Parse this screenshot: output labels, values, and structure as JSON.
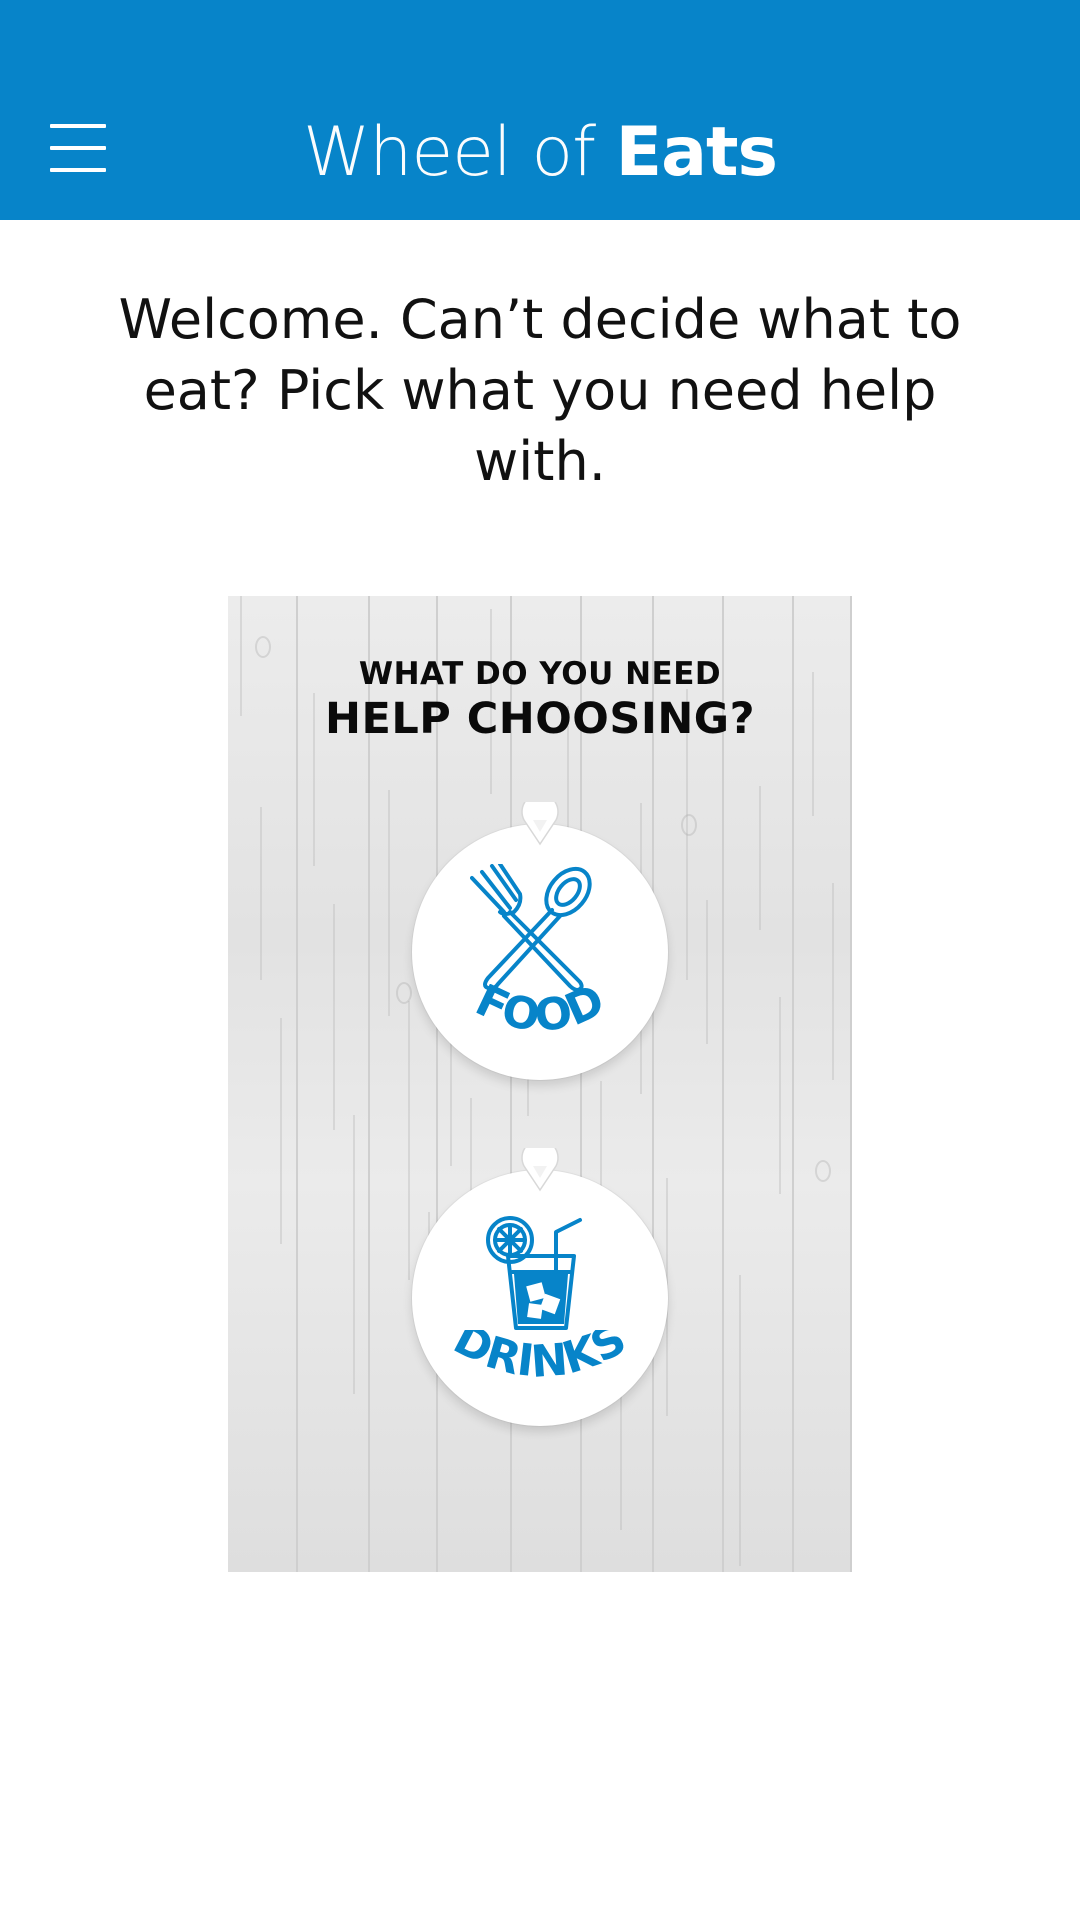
{
  "app": {
    "title_light": "Wheel of ",
    "title_bold": "Eats",
    "menu_icon": "hamburger-menu-icon",
    "brand_color": "#0784c9"
  },
  "main": {
    "welcome_text": "Welcome. Can’t decide what to eat? Pick what you need help with."
  },
  "board": {
    "heading_line1": "WHAT DO YOU NEED",
    "heading_line2": "HELP CHOOSING?",
    "choices": [
      {
        "label": "FOOD",
        "icon": "fork-spoon-icon"
      },
      {
        "label": "DRINKS",
        "icon": "drink-glass-icon"
      }
    ]
  }
}
